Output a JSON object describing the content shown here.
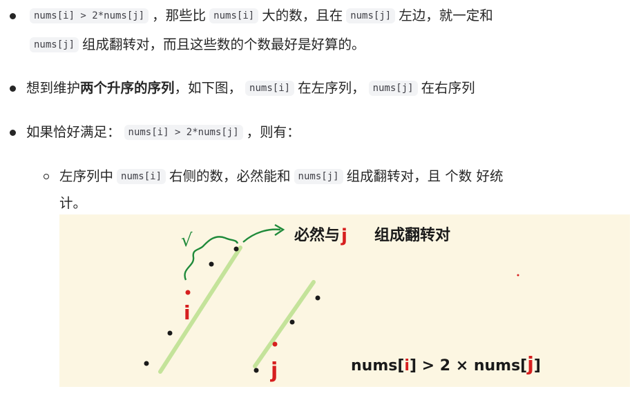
{
  "bullets": [
    {
      "code_a": "nums[i] > 2*nums[j]",
      "text_a": "，那些比",
      "code_b": "nums[i]",
      "text_b": "大的数，且在",
      "code_c": "nums[j]",
      "text_c": "左边，就一定和",
      "code_d": "nums[j]",
      "text_d": "组成翻转对，而且这些数的个数最好是好算的。"
    },
    {
      "text_a": "想到维护",
      "bold": "两个升序的序列",
      "text_b": "，如下图，",
      "code_a": "nums[i]",
      "text_c": "在左序列，",
      "code_b": "nums[j]",
      "text_d": "在右序列"
    },
    {
      "text_a": "如果恰好满足：",
      "code_a": "nums[i] > 2*nums[j]",
      "text_b": "，则有："
    }
  ],
  "sub_bullet": {
    "text_a": "左序列中",
    "code_a": "nums[i]",
    "text_b": "右侧的数，必然能和",
    "code_b": "nums[j]",
    "text_c": "组成翻转对，且 个数 好统",
    "text_d": "计。"
  },
  "figure": {
    "check_mark": "√",
    "annotation": "必然与",
    "annotation_j": "j",
    "annotation_tail": "组成翻转对",
    "label_i": "i",
    "label_j": "j",
    "formula_a": "nums[",
    "formula_i": "i",
    "formula_b": "] > 2 × nums[",
    "formula_j": "j",
    "formula_c": "]",
    "colors": {
      "background": "#fcf6e2",
      "sequence_line": "#c4e39a",
      "arrow": "#1f8a3a",
      "red": "#d61f1f",
      "ink": "#1a1a1a"
    }
  }
}
